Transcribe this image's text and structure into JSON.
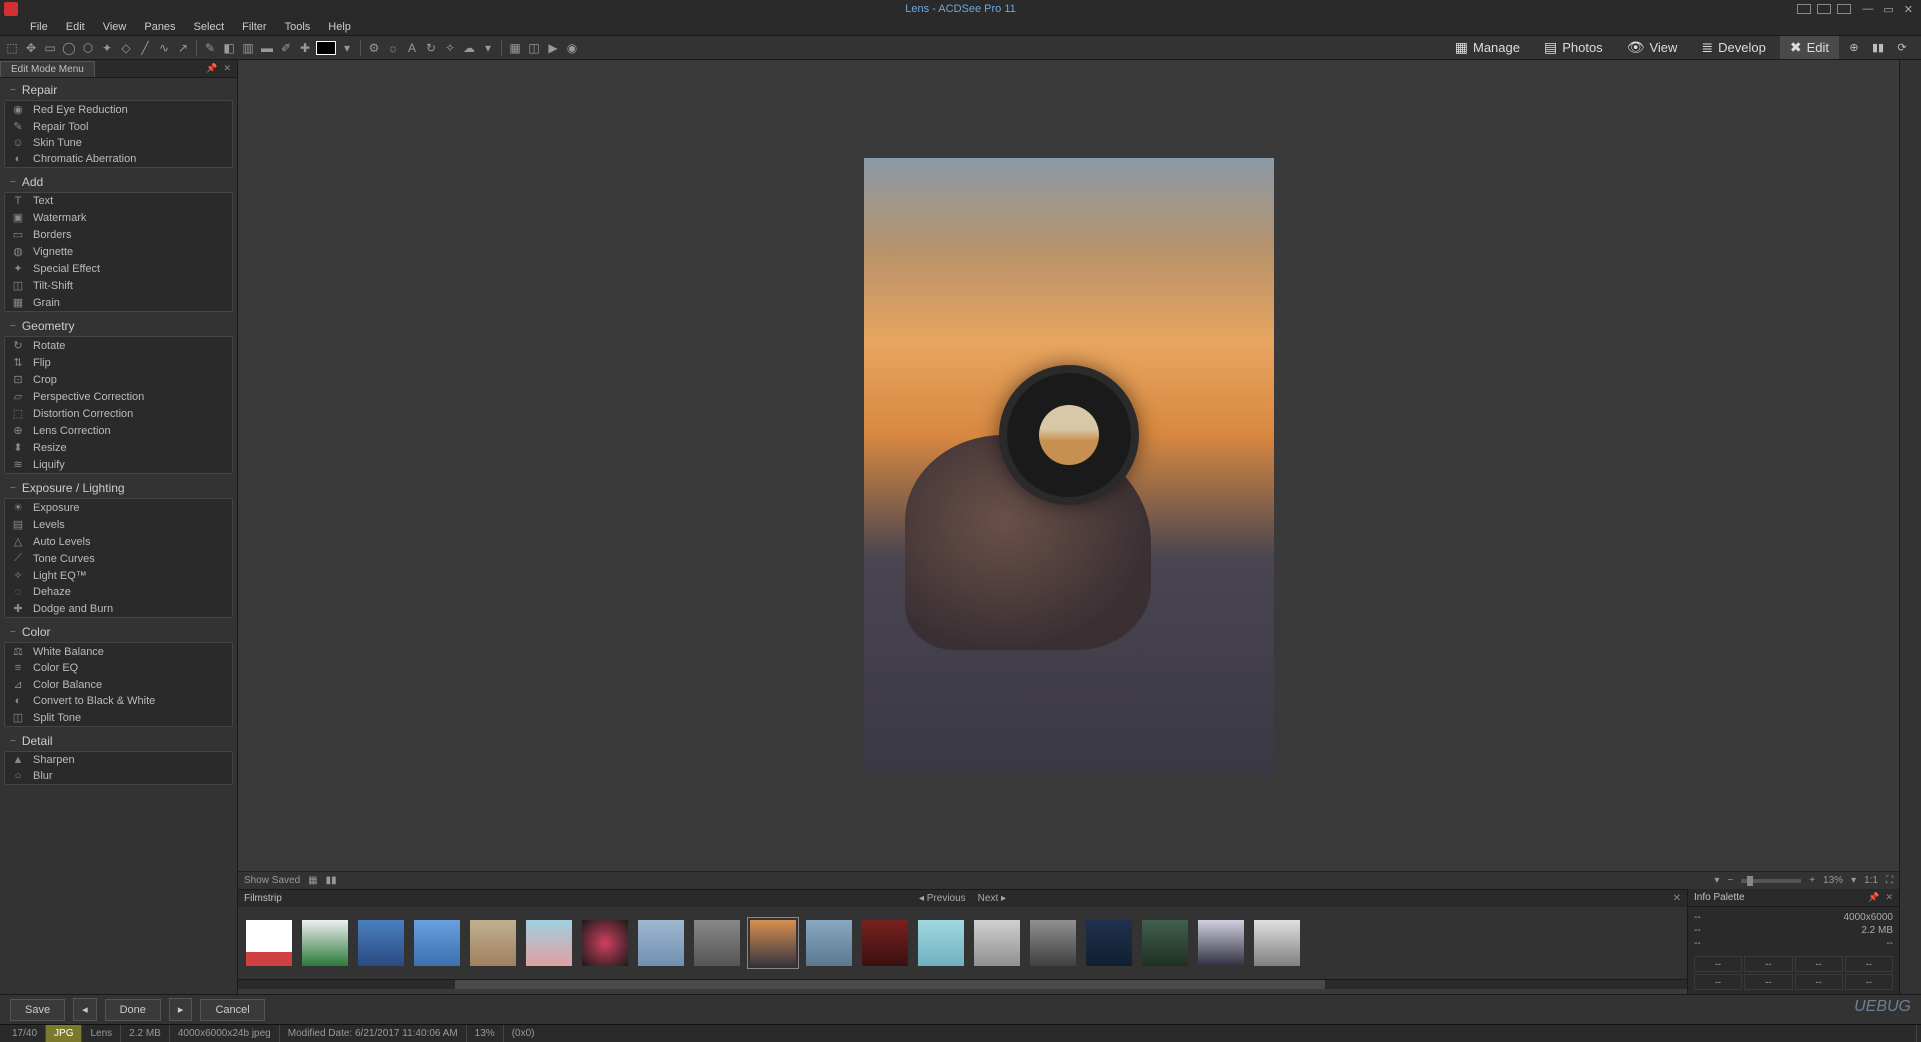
{
  "app": {
    "title": "Lens - ACDSee Pro 11"
  },
  "menu": {
    "items": [
      "File",
      "Edit",
      "View",
      "Panes",
      "Select",
      "Filter",
      "Tools",
      "Help"
    ]
  },
  "modes": {
    "items": [
      {
        "label": "Manage",
        "icon": "▦"
      },
      {
        "label": "Photos",
        "icon": "▤"
      },
      {
        "label": "View",
        "icon": "👁"
      },
      {
        "label": "Develop",
        "icon": "⚙"
      },
      {
        "label": "Edit",
        "icon": "✖",
        "active": true
      }
    ]
  },
  "left_panel": {
    "title": "Edit Mode Menu",
    "groups": [
      {
        "name": "Repair",
        "items": [
          "Red Eye Reduction",
          "Repair Tool",
          "Skin Tune",
          "Chromatic Aberration"
        ]
      },
      {
        "name": "Add",
        "items": [
          "Text",
          "Watermark",
          "Borders",
          "Vignette",
          "Special Effect",
          "Tilt-Shift",
          "Grain"
        ]
      },
      {
        "name": "Geometry",
        "items": [
          "Rotate",
          "Flip",
          "Crop",
          "Perspective Correction",
          "Distortion Correction",
          "Lens Correction",
          "Resize",
          "Liquify"
        ]
      },
      {
        "name": "Exposure / Lighting",
        "items": [
          "Exposure",
          "Levels",
          "Auto Levels",
          "Tone Curves",
          "Light EQ™",
          "Dehaze",
          "Dodge and Burn"
        ]
      },
      {
        "name": "Color",
        "items": [
          "White Balance",
          "Color EQ",
          "Color Balance",
          "Convert to Black & White",
          "Split Tone"
        ]
      },
      {
        "name": "Detail",
        "items": [
          "Sharpen",
          "Blur"
        ]
      }
    ]
  },
  "canvas_footer": {
    "show_saved": "Show Saved",
    "zoom": "13%",
    "ratio": "1:1"
  },
  "filmstrip": {
    "title": "Filmstrip",
    "prev": "Previous",
    "next": "Next",
    "thumbnails": 19,
    "selected_index": 9
  },
  "info_palette": {
    "title": "Info Palette",
    "dimensions": "4000x6000",
    "size": "2.2 MB",
    "dash": "--",
    "grid": [
      "--",
      "--",
      "--",
      "--",
      "--",
      "--",
      "--",
      "--"
    ]
  },
  "actions": {
    "save": "Save",
    "done": "Done",
    "cancel": "Cancel"
  },
  "status": {
    "index": "17/40",
    "format": "JPG",
    "name": "Lens",
    "size": "2.2 MB",
    "dims": "4000x6000x24b jpeg",
    "modified": "Modified Date: 6/21/2017 11:40:06 AM",
    "zoom": "13%",
    "coords": "(0x0)"
  },
  "watermark": "UEBUG"
}
